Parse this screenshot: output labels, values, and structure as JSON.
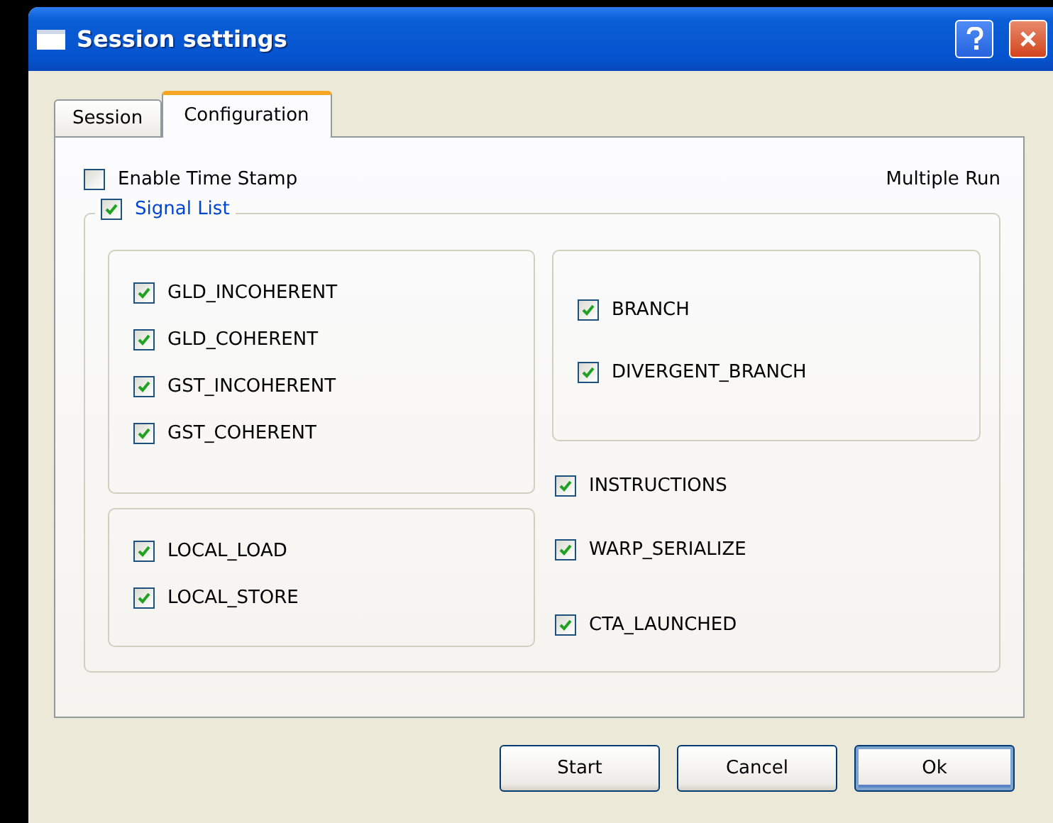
{
  "window": {
    "title": "Session settings"
  },
  "tabs": [
    {
      "label": "Session",
      "selected": false
    },
    {
      "label": "Configuration",
      "selected": true
    }
  ],
  "enable_time_stamp": {
    "label": "Enable Time Stamp",
    "checked": false
  },
  "multiple_run": "Multiple Run",
  "signal_list": {
    "label": "Signal List",
    "checked": true,
    "left_groups": [
      [
        {
          "label": "GLD_INCOHERENT",
          "checked": true
        },
        {
          "label": "GLD_COHERENT",
          "checked": true
        },
        {
          "label": "GST_INCOHERENT",
          "checked": true
        },
        {
          "label": "GST_COHERENT",
          "checked": true
        }
      ],
      [
        {
          "label": "LOCAL_LOAD",
          "checked": true
        },
        {
          "label": "LOCAL_STORE",
          "checked": true
        }
      ]
    ],
    "right_group": [
      {
        "label": "BRANCH",
        "checked": true
      },
      {
        "label": "DIVERGENT_BRANCH",
        "checked": true
      }
    ],
    "right_items": [
      {
        "label": "INSTRUCTIONS",
        "checked": true
      },
      {
        "label": "WARP_SERIALIZE",
        "checked": true
      },
      {
        "label": "CTA_LAUNCHED",
        "checked": true
      }
    ]
  },
  "buttons": [
    {
      "label": "Start",
      "default": false
    },
    {
      "label": "Cancel",
      "default": false
    },
    {
      "label": "Ok",
      "default": true
    }
  ]
}
